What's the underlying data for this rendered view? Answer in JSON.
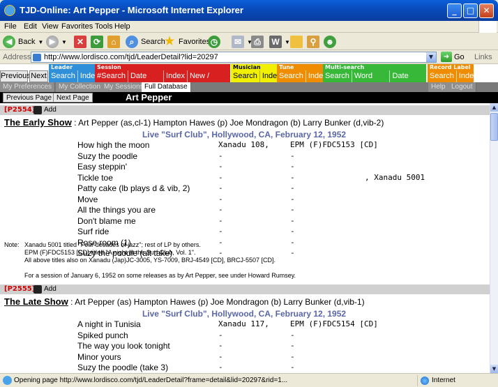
{
  "window": {
    "title": "TJD-Online: Art Pepper - Microsoft Internet Explorer"
  },
  "menu": [
    "File",
    "Edit",
    "View",
    "Favorites",
    "Tools",
    "Help"
  ],
  "toolbar": {
    "back": "Back",
    "search": "Search",
    "favorites": "Favorites"
  },
  "address": {
    "label": "Address",
    "url": "http://www.lordisco.com/tjd/LeaderDetail?lid=20297",
    "go": "Go",
    "links": "Links"
  },
  "nav": {
    "previous": "Previous",
    "next": "Next",
    "groups": [
      {
        "label": "Leader",
        "color": "#2f8fd8",
        "items": [
          "Search",
          "Index"
        ]
      },
      {
        "label": "Session",
        "color": "#d82020",
        "items": [
          "#Search",
          "Date Search",
          "Index",
          "New / Reissues"
        ]
      },
      {
        "label": "Musician",
        "color": "#f0f000",
        "text_color": "#000",
        "items": [
          "Search",
          "Index"
        ]
      },
      {
        "label": "Tune",
        "color": "#f08c00",
        "items": [
          "Search",
          "Index"
        ]
      },
      {
        "label": "Multi-search",
        "color": "#38b838",
        "items": [
          "Search",
          "Word Search",
          "Date Search"
        ]
      },
      {
        "label": "Record Label",
        "color": "#f08c00",
        "items": [
          "Search",
          "Index"
        ]
      }
    ]
  },
  "subnav": {
    "items": [
      "My Preferences",
      "My Collection",
      "My Sessions",
      "Full Database"
    ],
    "active": 3,
    "right": [
      "Help",
      "Logout"
    ]
  },
  "pagebar": {
    "prev": "Previous Page",
    "next": "Next Page",
    "name": "Art Pepper"
  },
  "sessions": [
    {
      "id": "[P2554]",
      "add": "Add",
      "title": "The Early Show",
      "personnel": " : Art Pepper (as,cl-1) Hampton Hawes (p) Joe Mondragon (b) Larry Bunker (d,vib-2)",
      "location": "Live \"Surf Club\", Hollywood, CA, February 12, 1952",
      "tracks": [
        {
          "title": "How high the moon",
          "c1": "Xanadu 108,",
          "c2": "EPM (F)FDC5153 [CD]",
          "c3": ""
        },
        {
          "title": "Suzy the poodle",
          "c1": "-",
          "c2": "-",
          "c3": ""
        },
        {
          "title": "Easy steppin'",
          "c1": "-",
          "c2": "-",
          "c3": ""
        },
        {
          "title": "Tickle toe",
          "c1": "-",
          "c2": "-",
          "c3": ", Xanadu 5001"
        },
        {
          "title": "Patty cake (lb plays d & vib, 2)",
          "c1": "-",
          "c2": "-",
          "c3": ""
        },
        {
          "title": "Move",
          "c1": "-",
          "c2": "-",
          "c3": ""
        },
        {
          "title": "All the things you are",
          "c1": "-",
          "c2": "-",
          "c3": ""
        },
        {
          "title": "Don't blame me",
          "c1": "-",
          "c2": "-",
          "c3": ""
        },
        {
          "title": "Surf ride",
          "c1": "-",
          "c2": "-",
          "c3": ""
        },
        {
          "title": "Rose room (1)",
          "c1": "-",
          "c2": "-",
          "c3": ""
        },
        {
          "title": "Suzy the poodle (alt take)",
          "c1": "-",
          "c2": "-",
          "c3": ""
        }
      ],
      "note_label": "Note:",
      "notes": [
        "Xanadu 5001 titled \"Four decades of jazz\"; rest of LP by others.",
        "EPM (F)FDC5153 [CD] titled \"A night at the Surf Club, Vol. 1\".",
        "All above titles also on Xanadu (Jap)JC-3005, YS-7009, BRJ-4549 [CD], BRCJ-5507 [CD].",
        "",
        "For a session of January 6, 1952 on some releases as by Art Pepper, see under Howard Rumsey."
      ]
    },
    {
      "id": "[P2555]",
      "add": "Add",
      "title": "The Late Show",
      "personnel": " : Art Pepper (as) Hampton Hawes (p) Joe Mondragon (b) Larry Bunker (d,vib-1)",
      "location": "Live \"Surf Club\", Hollywood, CA, February 12, 1952",
      "tracks": [
        {
          "title": "A night in Tunisia",
          "c1": "Xanadu 117,",
          "c2": "EPM (F)FDC5154 [CD]",
          "c3": ""
        },
        {
          "title": "Spiked punch",
          "c1": "-",
          "c2": "-",
          "c3": ""
        },
        {
          "title": "The way you look tonight",
          "c1": "-",
          "c2": "-",
          "c3": ""
        },
        {
          "title": "Minor yours",
          "c1": "-",
          "c2": "-",
          "c3": ""
        },
        {
          "title": "Suzy the poodle (take 3)",
          "c1": "-",
          "c2": "-",
          "c3": ""
        }
      ]
    }
  ],
  "status": {
    "text": "Opening page http://www.lordisco.com/tjd/LeaderDetail?frame=detail&lid=20297&rid=1...",
    "zone": "Internet"
  }
}
